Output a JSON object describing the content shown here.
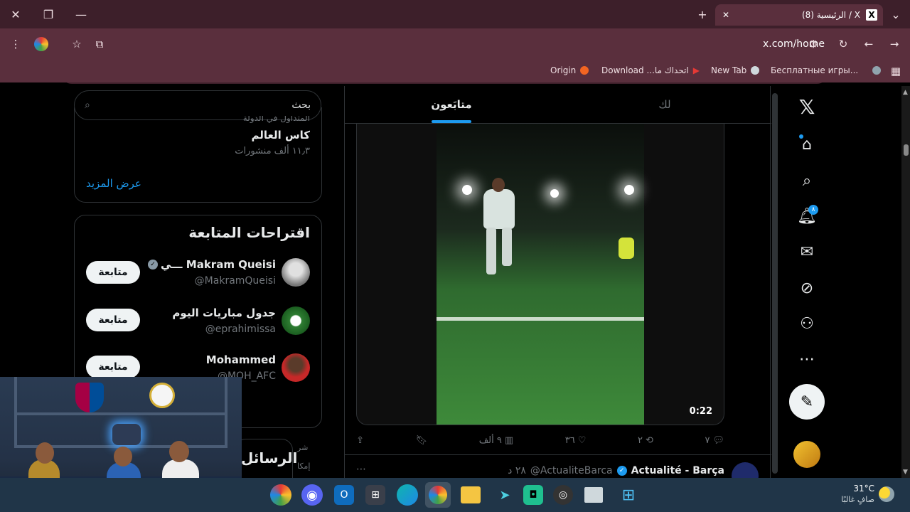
{
  "browser": {
    "tab_title": "(8) الرئيسية / X",
    "url": "x.com/home",
    "bookmarks": [
      {
        "label": "Origin",
        "color": "#f26522"
      },
      {
        "label": "Download ...اتحداك ما",
        "color": "#e53935"
      },
      {
        "label": "New Tab",
        "color": "#cfd8dc"
      },
      {
        "label": "Бесплатные игры...",
        "color": "#90a4ae"
      }
    ]
  },
  "nav": {
    "badge_count": "٨"
  },
  "feed": {
    "tab_for_you": "لك",
    "tab_following": "متابَعون",
    "video_duration": "0:22",
    "actions": {
      "replies": "٧",
      "reposts": "٢",
      "likes": "٣٦",
      "views": "٩ ألف"
    },
    "next_tweet": {
      "author": "Actualité - Barça",
      "handle": "@ActualiteBarca",
      "time": "٢٨ د"
    }
  },
  "sidebar": {
    "search_placeholder": "بحث",
    "trend_partial": "المتداول في الدولة",
    "trend_name": "كاس العالم",
    "trend_count": "١١٫٣ ألف منشورات",
    "show_more": "عرض المزيد",
    "who_to_follow_title": "اقتراحات المتابعة",
    "follow_label": "متابعة",
    "suggestions": [
      {
        "name": "Makram Queisi ـــي",
        "handle": "@MakramQueisi",
        "verified": true
      },
      {
        "name": "جدول مباريات اليوم",
        "handle": "@eprahimissa",
        "verified": false
      },
      {
        "name": "Mohammed",
        "handle": "@MOH_AFC",
        "verified": false
      }
    ],
    "messages_title": "الرسائل",
    "footer_partial_1": "شر",
    "footer_partial_2": "إمكا"
  },
  "taskbar": {
    "weather_temp": "31°C",
    "weather_desc": "صافٍ غالبًا"
  }
}
